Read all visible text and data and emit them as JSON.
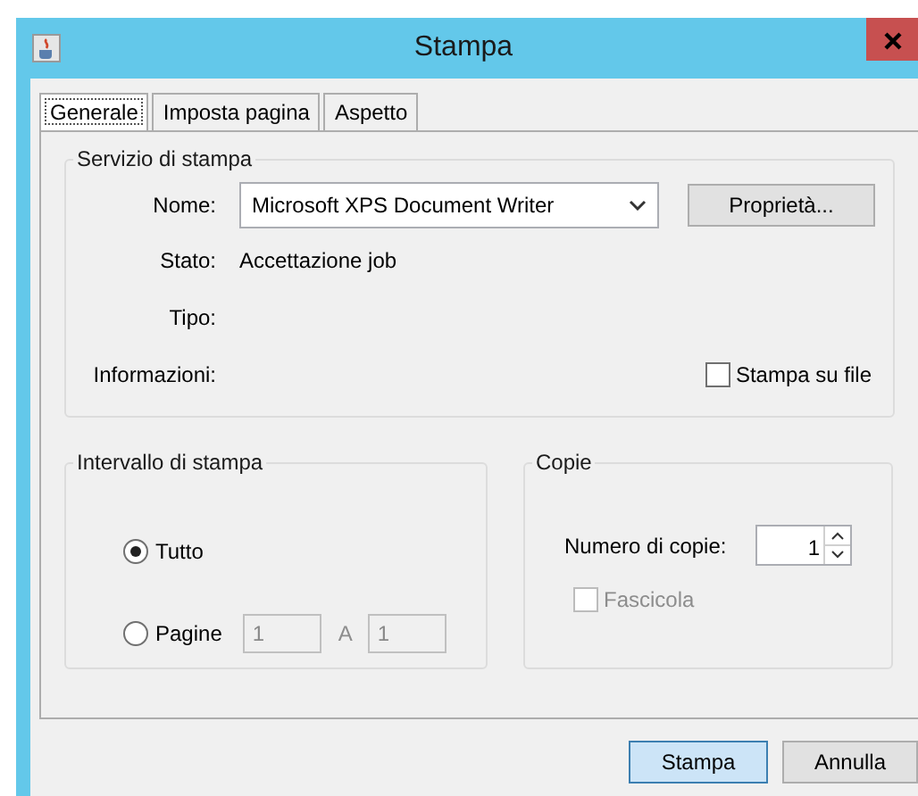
{
  "window": {
    "title": "Stampa"
  },
  "tabs": [
    {
      "label": "Generale",
      "selected": true
    },
    {
      "label": "Imposta pagina",
      "selected": false
    },
    {
      "label": "Aspetto",
      "selected": false
    }
  ],
  "print_service": {
    "title": "Servizio di stampa",
    "name_label": "Nome:",
    "printer": "Microsoft XPS Document Writer",
    "properties_button": "Proprietà...",
    "status_label": "Stato:",
    "status": "Accettazione job",
    "type_label": "Tipo:",
    "info_label": "Informazioni:",
    "print_to_file": {
      "label": "Stampa su file",
      "checked": false
    }
  },
  "print_range": {
    "title": "Intervallo di stampa",
    "options": [
      {
        "label": "Tutto",
        "selected": true
      },
      {
        "label": "Pagine",
        "selected": false
      }
    ],
    "from": "1",
    "to_label": "A",
    "to": "1"
  },
  "copies": {
    "title": "Copie",
    "count_label": "Numero di copie:",
    "count": "1",
    "collate": {
      "label": "Fascicola",
      "checked": false,
      "disabled": true
    }
  },
  "buttons": [
    {
      "label": "Stampa",
      "default": true
    },
    {
      "label": "Annulla",
      "default": false
    }
  ]
}
